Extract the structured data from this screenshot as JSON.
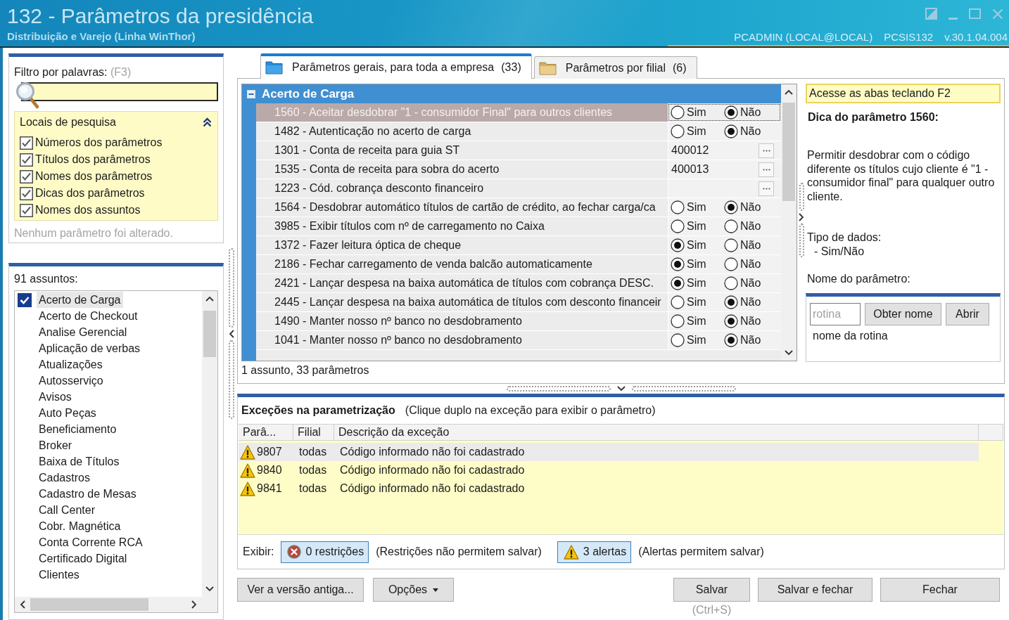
{
  "window": {
    "title": "132 - Parâmetros da presidência",
    "subtitle": "Distribuição e Varejo (Linha WinThor)",
    "user": "PCADMIN (LOCAL@LOCAL)",
    "program": "PCSIS132",
    "version": "v.30.1.04.004"
  },
  "filter": {
    "label": "Filtro por palavras:",
    "shortcut": "(F3)",
    "search_locations": {
      "title": "Locais de pesquisa",
      "expanded": true,
      "options": [
        {
          "label": "Números dos parâmetros",
          "checked": true
        },
        {
          "label": "Títulos dos parâmetros",
          "checked": true
        },
        {
          "label": "Nomes dos parâmetros",
          "checked": true
        },
        {
          "label": "Dicas dos parâmetros",
          "checked": true
        },
        {
          "label": "Nomes dos assuntos",
          "checked": true
        }
      ]
    },
    "status": "Nenhum parâmetro foi alterado."
  },
  "subjects": {
    "count_label": "91 assuntos:",
    "items": [
      {
        "label": "Acerto de Carga",
        "checked": true,
        "selected": true
      },
      {
        "label": "Acerto de Checkout",
        "checked": false,
        "selected": false
      },
      {
        "label": "Analise Gerencial",
        "checked": false,
        "selected": false
      },
      {
        "label": "Aplicação de verbas",
        "checked": false,
        "selected": false
      },
      {
        "label": "Atualizações",
        "checked": false,
        "selected": false
      },
      {
        "label": "Autosserviço",
        "checked": false,
        "selected": false
      },
      {
        "label": "Avisos",
        "checked": false,
        "selected": false
      },
      {
        "label": "Auto Peças",
        "checked": false,
        "selected": false
      },
      {
        "label": "Beneficiamento",
        "checked": false,
        "selected": false
      },
      {
        "label": "Broker",
        "checked": false,
        "selected": false
      },
      {
        "label": "Baixa de Títulos",
        "checked": false,
        "selected": false
      },
      {
        "label": "Cadastros",
        "checked": false,
        "selected": false
      },
      {
        "label": "Cadastro de Mesas",
        "checked": false,
        "selected": false
      },
      {
        "label": "Call Center",
        "checked": false,
        "selected": false
      },
      {
        "label": "Cobr. Magnética",
        "checked": false,
        "selected": false
      },
      {
        "label": "Conta Corrente RCA",
        "checked": false,
        "selected": false
      },
      {
        "label": "Certificado Digital",
        "checked": false,
        "selected": false
      },
      {
        "label": "Clientes",
        "checked": false,
        "selected": false
      }
    ]
  },
  "tabs": [
    {
      "label": "Parâmetros gerais, para toda a empresa",
      "count": "(33)",
      "selected": true
    },
    {
      "label": "Parâmetros por filial",
      "count": "(6)",
      "selected": false
    }
  ],
  "grid": {
    "group": {
      "title": "Acerto de Carga",
      "expanded": true
    },
    "rows": [
      {
        "kind": "yesno",
        "label": "1560 - Aceitar desdobrar \"1 - consumidor Final\" para outros clientes",
        "selected": true,
        "options": [
          {
            "label": "Sim",
            "selected": false
          },
          {
            "label": "Não",
            "selected": true
          }
        ]
      },
      {
        "kind": "yesno",
        "label": "1482 - Autenticação no acerto de carga",
        "selected": false,
        "options": [
          {
            "label": "Sim",
            "selected": false
          },
          {
            "label": "Não",
            "selected": true
          }
        ]
      },
      {
        "kind": "lookup",
        "label": "1301 - Conta de receita para guia ST",
        "selected": false,
        "value": "400012"
      },
      {
        "kind": "lookup",
        "label": "1535 - Conta de receita para sobra do acerto",
        "selected": false,
        "value": "400013"
      },
      {
        "kind": "lookup",
        "label": "1223 - Cód. cobrança desconto financeiro",
        "selected": false
      },
      {
        "kind": "yesno",
        "label": "1564 - Desdobrar automático títulos de cartão de crédito, ao fechar carga/ca",
        "selected": false,
        "options": [
          {
            "label": "Sim",
            "selected": false
          },
          {
            "label": "Não",
            "selected": true
          }
        ]
      },
      {
        "kind": "yesno",
        "label": "3985 - Exibir títulos com nº de carregamento no Caixa",
        "selected": false,
        "options": [
          {
            "label": "Sim",
            "selected": false
          },
          {
            "label": "Não",
            "selected": false
          }
        ]
      },
      {
        "kind": "yesno",
        "label": "1372 - Fazer leitura óptica de cheque",
        "selected": false,
        "options": [
          {
            "label": "Sim",
            "selected": true
          },
          {
            "label": "Não",
            "selected": false
          }
        ]
      },
      {
        "kind": "yesno",
        "label": "2186 - Fechar carregamento de venda balcão automaticamente",
        "selected": false,
        "options": [
          {
            "label": "Sim",
            "selected": true
          },
          {
            "label": "Não",
            "selected": false
          }
        ]
      },
      {
        "kind": "yesno",
        "label": "2421 - Lançar despesa na baixa automática de títulos com cobrança DESC.",
        "selected": false,
        "options": [
          {
            "label": "Sim",
            "selected": true
          },
          {
            "label": "Não",
            "selected": false
          }
        ]
      },
      {
        "kind": "yesno",
        "label": "2445 - Lançar despesa na baixa automática de títulos com desconto financeir",
        "selected": false,
        "options": [
          {
            "label": "Sim",
            "selected": false
          },
          {
            "label": "Não",
            "selected": true
          }
        ]
      },
      {
        "kind": "yesno",
        "label": "1490 - Manter nosso nº banco no desdobramento",
        "selected": false,
        "options": [
          {
            "label": "Sim",
            "selected": false
          },
          {
            "label": "Não",
            "selected": true
          }
        ]
      },
      {
        "kind": "yesno",
        "label": "1041 - Manter nosso nº banco no desdobramento",
        "selected": false,
        "options": [
          {
            "label": "Sim",
            "selected": false
          },
          {
            "label": "Não",
            "selected": true
          }
        ]
      }
    ],
    "summary": "1 assunto, 33 parâmetros"
  },
  "tip": {
    "hint": "Acesse as abas teclando F2",
    "title": "Dica do parâmetro 1560:",
    "text": "Permitir desdobrar com o código diferente os títulos cujo cliente é \"1 - consumidor final\" para qualquer outro cliente.",
    "data_type_label": "Tipo de dados:",
    "data_type": "- Sim/Não",
    "name_label": "Nome do parâmetro:",
    "lookup": {
      "placeholder": "rotina",
      "buttons": [
        "Obter nome",
        "Abrir"
      ],
      "result": "nome da rotina"
    }
  },
  "exceptions": {
    "title": "Exceções na parametrização",
    "hint": "(Clique duplo na exceção para exibir o parâmetro)",
    "columns": [
      "Parâ...",
      "Filial",
      "Descrição da exceção"
    ],
    "rows": [
      {
        "param": "9807",
        "branch": "todas",
        "description": "Código informado não foi cadastrado",
        "selected": true
      },
      {
        "param": "9840",
        "branch": "todas",
        "description": "Código informado não foi cadastrado",
        "selected": false
      },
      {
        "param": "9841",
        "branch": "todas",
        "description": "Código informado não foi cadastrado",
        "selected": false
      }
    ],
    "filter": {
      "label": "Exibir:",
      "toggles": [
        {
          "kind": "restriction",
          "label": "0 restrições",
          "note": "(Restrições não permitem salvar)",
          "on": true
        },
        {
          "kind": "alert",
          "label": "3 alertas",
          "note": "(Alertas permitem salvar)",
          "on": true
        }
      ]
    }
  },
  "footer": {
    "left": [
      {
        "kind": "button",
        "label": "Ver a versão antiga..."
      },
      {
        "kind": "menu",
        "label": "Opções"
      }
    ],
    "right": [
      {
        "label": "Salvar",
        "shortcut": "(Ctrl+S)"
      },
      {
        "label": "Salvar e fechar"
      },
      {
        "label": "Fechar"
      }
    ]
  }
}
